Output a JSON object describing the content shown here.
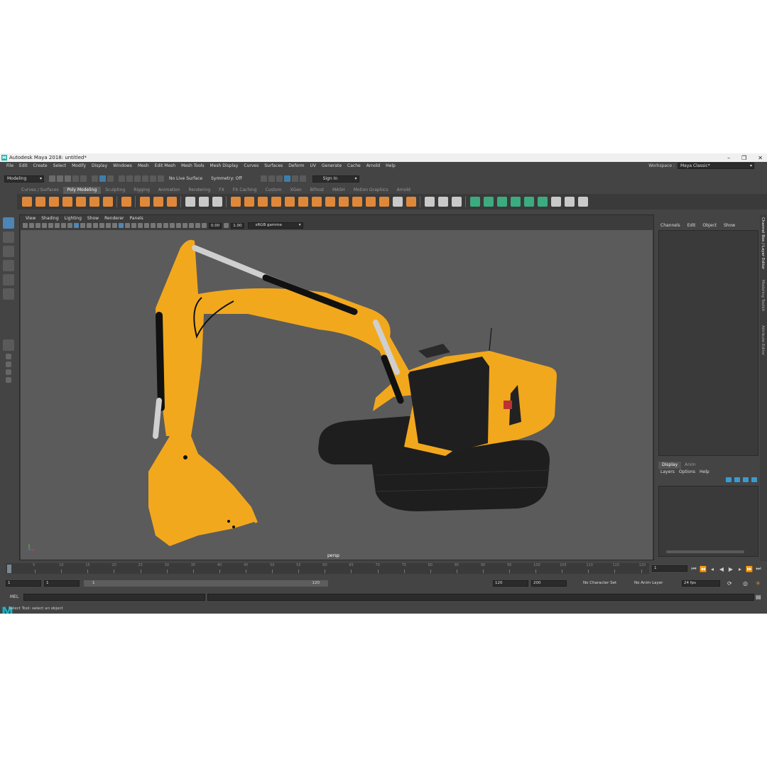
{
  "window": {
    "title": "Autodesk Maya 2018: untitled*",
    "logo": "M",
    "minimize": "–",
    "maximize": "❐",
    "close": "✕"
  },
  "menu": [
    "File",
    "Edit",
    "Create",
    "Select",
    "Modify",
    "Display",
    "Windows",
    "Mesh",
    "Edit Mesh",
    "Mesh Tools",
    "Mesh Display",
    "Curves",
    "Surfaces",
    "Deform",
    "UV",
    "Generate",
    "Cache",
    "Arnold",
    "Help"
  ],
  "workspace": {
    "label": "Workspace :",
    "value": "Maya Classic*"
  },
  "status": {
    "mode": "Modeling",
    "live_surface": "No Live Surface",
    "symmetry": "Symmetry: Off",
    "sign_in": "Sign In"
  },
  "shelf_tabs": [
    "Curves / Surfaces",
    "Poly Modeling",
    "Sculpting",
    "Rigging",
    "Animation",
    "Rendering",
    "FX",
    "FX Caching",
    "Custom",
    "XGen",
    "Bifrost",
    "MASH",
    "Motion Graphics",
    "Arnold"
  ],
  "active_shelf": "Poly Modeling",
  "viewport": {
    "menu": [
      "View",
      "Shading",
      "Lighting",
      "Show",
      "Renderer",
      "Panels"
    ],
    "exposure": "0.00",
    "gamma": "1.00",
    "color_space": "sRGB gamma",
    "camera": "persp"
  },
  "channel_box": {
    "menu": [
      "Channels",
      "Edit",
      "Object",
      "Show"
    ],
    "layer_tabs": [
      "Display",
      "Anim"
    ],
    "layer_menu": [
      "Layers",
      "Options",
      "Help"
    ]
  },
  "side_tabs": [
    "Channel Box / Layer Editor",
    "Modeling Toolkit",
    "Attribute Editor"
  ],
  "timeline": {
    "ticks": [
      "5",
      "10",
      "15",
      "20",
      "25",
      "30",
      "35",
      "40",
      "45",
      "50",
      "55",
      "60",
      "65",
      "70",
      "75",
      "80",
      "85",
      "90",
      "95",
      "100",
      "105",
      "110",
      "115",
      "120"
    ],
    "current_frame": "1",
    "start": "1",
    "start_inner": "1",
    "range_start_label": "1",
    "range_end_label": "120",
    "end_inner": "120",
    "end": "200",
    "character_set": "No Character Set",
    "anim_layer": "No Anim Layer",
    "fps": "24 fps"
  },
  "command": {
    "lang": "MEL",
    "help": "Select Tool: select an object"
  },
  "colors": {
    "excavator_yellow": "#f2a81d",
    "tracks": "#1e1e1e",
    "viewport_bg": "#5b5b5b",
    "accent": "#4d85b4"
  }
}
